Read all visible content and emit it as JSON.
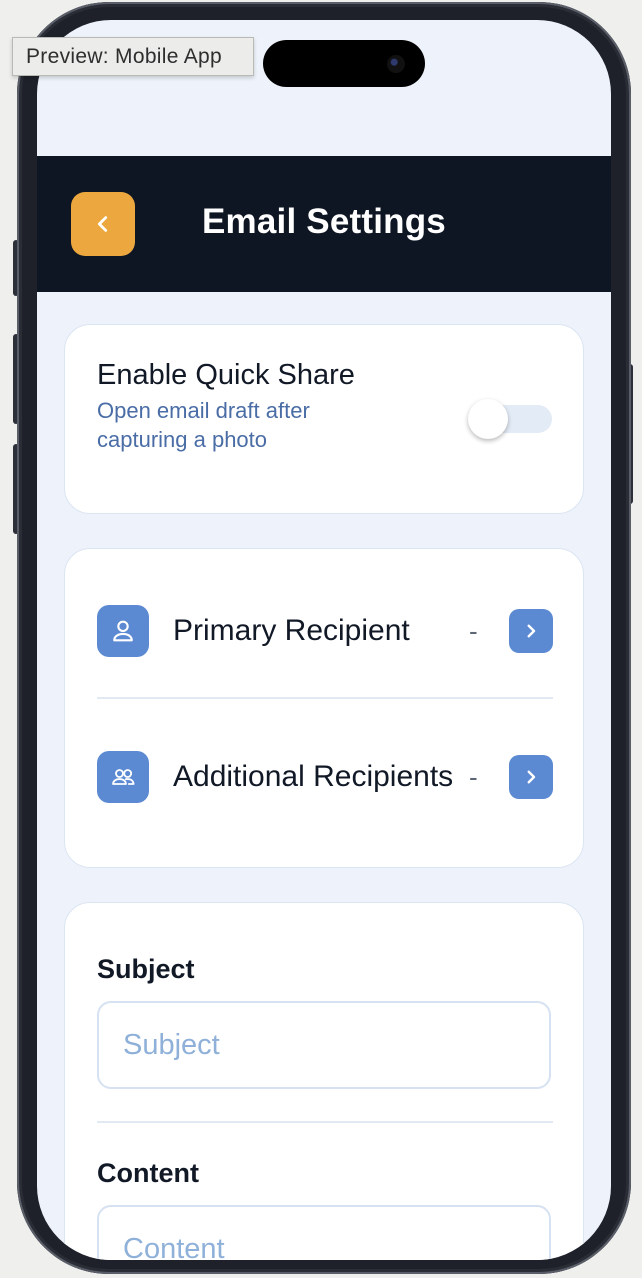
{
  "preview_tooltip": "Preview: Mobile App",
  "header": {
    "title": "Email Settings"
  },
  "quick_share": {
    "title": "Enable Quick Share",
    "description": "Open email draft after capturing a photo",
    "enabled": false
  },
  "recipients": [
    {
      "label": "Primary Recipient",
      "value": "-",
      "icon": "user-icon"
    },
    {
      "label": "Additional Recipients",
      "value": "-",
      "icon": "users-icon"
    }
  ],
  "form": {
    "subject_label": "Subject",
    "subject_placeholder": "Subject",
    "subject_value": "",
    "content_label": "Content",
    "content_placeholder": "Content",
    "content_value": ""
  },
  "colors": {
    "accent": "#eca83e",
    "header_bg": "#0f1623",
    "primary_blue": "#5b89d2",
    "screen_bg": "#eef3fb"
  }
}
